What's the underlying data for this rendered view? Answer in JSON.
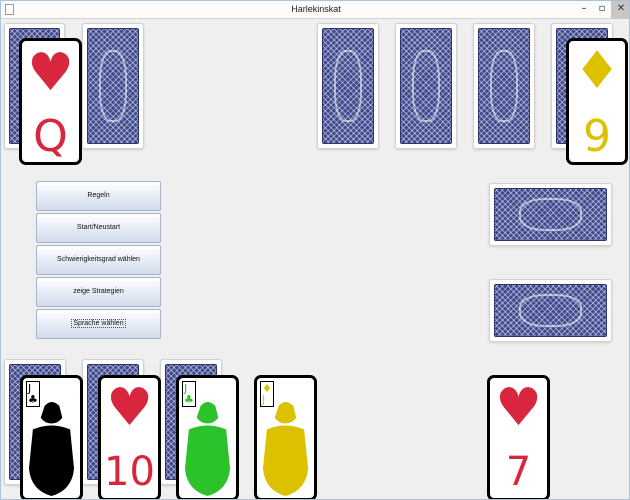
{
  "window": {
    "title": "Harlekinskat",
    "controls": {
      "minimize": "–",
      "maximize": "▫",
      "close": "✕"
    }
  },
  "menu": {
    "rules": "Regeln",
    "start": "Start/Neustart",
    "difficulty": "Schwierigkeitsgrad wählen",
    "strategies": "zeige Strategien",
    "language": "Sprache wählen"
  },
  "colors": {
    "red": "#d7263d",
    "green": "#2bc22b",
    "yellow": "#dcc100",
    "black": "#000000",
    "card_back": "#3f4a8e"
  },
  "cards": {
    "west_top": {
      "rank": "Q",
      "suit": "hearts",
      "symbol": "♥"
    },
    "east_top": {
      "rank": "9",
      "suit": "diamonds",
      "symbol": "♦"
    },
    "played": {
      "rank": "7",
      "suit": "hearts",
      "symbol": "♥"
    },
    "hand": [
      {
        "rank": "J",
        "suit": "clubs",
        "symbol": "♣",
        "color": "black"
      },
      {
        "rank": "10",
        "suit": "hearts",
        "symbol": "♥",
        "color": "red"
      },
      {
        "rank": "J",
        "suit": "clubs",
        "symbol": "♣",
        "color": "green"
      },
      {
        "rank": "J",
        "suit": "diamonds",
        "symbol": "♦",
        "color": "yellow"
      }
    ]
  }
}
